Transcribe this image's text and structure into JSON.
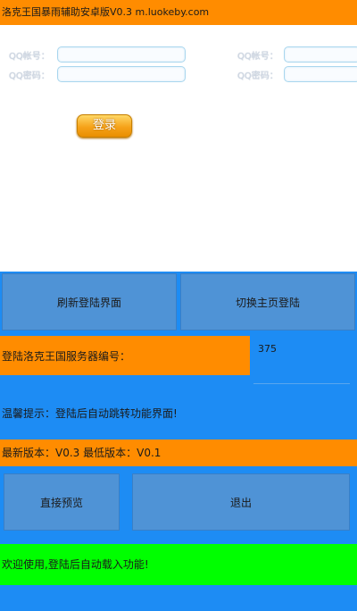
{
  "app": {
    "title": "洛克王国暴雨辅助安卓版V0.3 m.luokeby.com"
  },
  "login": {
    "qq_account_label": "QQ帐号：",
    "qq_password_label": "QQ密码：",
    "account_left_value": "",
    "password_left_value": "",
    "account_right_value": "",
    "password_right_value": "",
    "login_button": "登录"
  },
  "controls": {
    "refresh_button": "刷新登陆界面",
    "switch_button": "切换主页登陆",
    "server_label": "登陆洛克王国服务器编号：",
    "server_value": "375",
    "tip": "温馨提示：登陆后自动跳转功能界面!",
    "version": "最新版本：V0.3 最低版本：V0.1",
    "preview_button": "直接预览",
    "exit_button": "退出",
    "welcome": "欢迎使用,登陆后自动载入功能!"
  },
  "colors": {
    "orange": "#ff8c00",
    "blue": "#1d8cf4",
    "button_blue": "#4f93d6",
    "green": "#00ff00"
  }
}
